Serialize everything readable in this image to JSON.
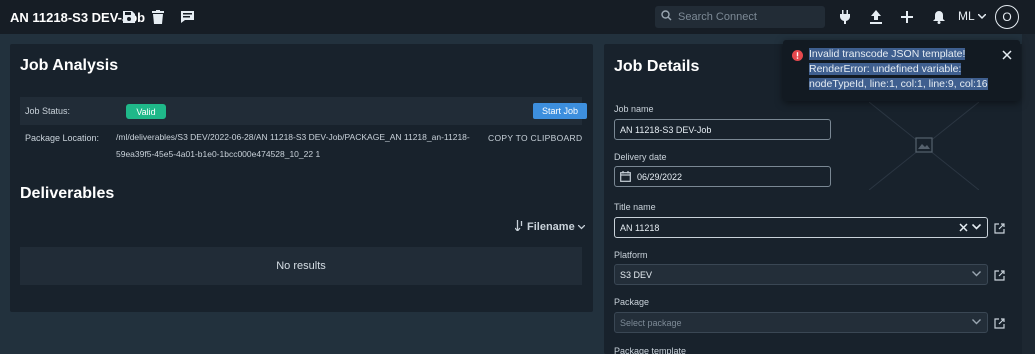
{
  "header": {
    "title": "AN 11218-S3 DEV-Job",
    "search_placeholder": "Search Connect",
    "user_initials": "ML",
    "avatar_letter": "O"
  },
  "job_analysis": {
    "title": "Job Analysis",
    "status_label": "Job Status:",
    "status_value": "Valid",
    "start_button": "Start Job",
    "package_label": "Package Location:",
    "package_path_line1": "/ml/deliverables/S3 DEV/2022-06-28/AN 11218-S3 DEV-Job/PACKAGE_AN 11218_an-11218-",
    "package_path_line2": "59ea39f5-45e5-4a01-b1e0-1bcc000e474528_10_22 1",
    "copy_button": "COPY TO CLIPBOARD"
  },
  "deliverables": {
    "title": "Deliverables",
    "sort_label": "Filename",
    "empty_text": "No results"
  },
  "job_details": {
    "title": "Job Details",
    "job_name_label": "Job name",
    "job_name_value": "AN 11218-S3 DEV-Job",
    "delivery_date_label": "Delivery date",
    "delivery_date_value": "06/29/2022",
    "title_name_label": "Title name",
    "title_name_value": "AN 11218",
    "platform_label": "Platform",
    "platform_value": "S3 DEV",
    "package_label": "Package",
    "package_placeholder": "Select package",
    "package_template_label": "Package template"
  },
  "toast": {
    "line1": "Invalid transcode JSON template!",
    "line2": "RenderError: undefined variable:",
    "line3": "nodeTypeId, line:1, col:1, line:9, col:16"
  },
  "colors": {
    "background": "#22313d",
    "panel": "#18222c",
    "topbar": "#161d25",
    "valid_green": "#1fb889",
    "primary_blue": "#3d8fde",
    "error_red": "#e5484d",
    "selection_highlight": "#3f5f8f"
  },
  "icons": [
    "save-icon",
    "delete-icon",
    "comment-icon",
    "search-icon",
    "plug-icon",
    "upload-icon",
    "plus-icon",
    "bell-icon",
    "chevron-down-icon",
    "calendar-icon",
    "clear-icon",
    "external-link-icon",
    "image-placeholder-icon",
    "error-icon",
    "close-icon",
    "sort-icon"
  ]
}
